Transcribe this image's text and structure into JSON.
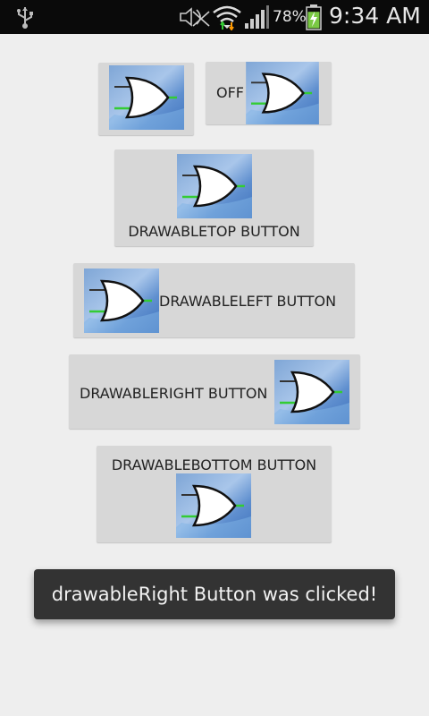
{
  "status_bar": {
    "battery_percent": "78%",
    "time": "9:34 AM",
    "icons": [
      "usb-icon",
      "mute-icon",
      "wifi-icon",
      "signal-icon",
      "battery-charging-icon"
    ],
    "battery_level": 0.78,
    "colors": {
      "background": "#0a0a0a",
      "battery_fill": "#7ac943"
    }
  },
  "buttons": {
    "image_button": {
      "icon": "or-gate-icon"
    },
    "toggle_button": {
      "label": "OFF",
      "icon": "or-gate-icon",
      "state": "off"
    },
    "drawable_top": {
      "label": "DRAWABLETOP BUTTON",
      "icon": "or-gate-icon"
    },
    "drawable_left": {
      "label": "DRAWABLELEFT BUTTON",
      "icon": "or-gate-icon"
    },
    "drawable_right": {
      "label": "DRAWABLERIGHT BUTTON",
      "icon": "or-gate-icon"
    },
    "drawable_bottom": {
      "label": "DRAWABLEBOTTOM BUTTON",
      "icon": "or-gate-icon"
    }
  },
  "toast": {
    "message": "drawableRight Button was clicked!"
  },
  "colors": {
    "page_background": "#eeeeee",
    "button_background": "#d7d7d7",
    "toast_background": "#333333",
    "gate_input_green": "#33cc33"
  }
}
